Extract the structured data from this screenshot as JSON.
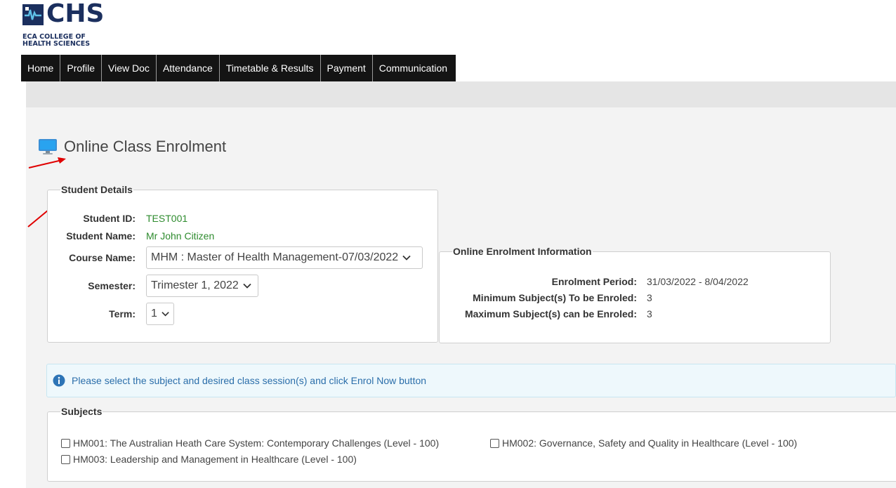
{
  "logo": {
    "brand": "CHS",
    "line1": "ECA COLLEGE OF",
    "line2": "HEALTH SCIENCES"
  },
  "nav": {
    "tabs": [
      "Home",
      "Profile",
      "View Doc",
      "Attendance",
      "Timetable & Results",
      "Payment",
      "Communication"
    ]
  },
  "page": {
    "title": "Online Class Enrolment",
    "icon": "monitor-icon"
  },
  "student_details": {
    "legend": "Student Details",
    "student_id_label": "Student ID:",
    "student_id": "TEST001",
    "student_name_label": "Student Name:",
    "student_name": "Mr John Citizen",
    "course_label": "Course Name:",
    "course_value": "MHM : Master of Health Management-07/03/2022",
    "semester_label": "Semester:",
    "semester_value": "Trimester 1, 2022",
    "term_label": "Term:",
    "term_value": "1"
  },
  "enrolment_info": {
    "legend": "Online Enrolment Information",
    "period_label": "Enrolment Period:",
    "period_value": "31/03/2022 - 8/04/2022",
    "min_label": "Minimum Subject(s) To be Enroled:",
    "min_value": "3",
    "max_label": "Maximum Subject(s) can be Enroled:",
    "max_value": "3"
  },
  "notice": {
    "text": "Please select the subject and desired class session(s) and click Enrol Now button"
  },
  "subjects": {
    "legend": "Subjects",
    "items": [
      "HM001: The Australian Heath Care System: Contemporary Challenges (Level - 100)",
      "HM002: Governance, Safety and Quality in Healthcare (Level - 100)",
      "HM003: Leadership and Management in Healthcare (Level - 100)"
    ]
  },
  "colors": {
    "accent_green": "#2e8b2e",
    "info_blue": "#2b6eaa",
    "brand_navy": "#1b2f5e",
    "arrow_red": "#e00000"
  }
}
